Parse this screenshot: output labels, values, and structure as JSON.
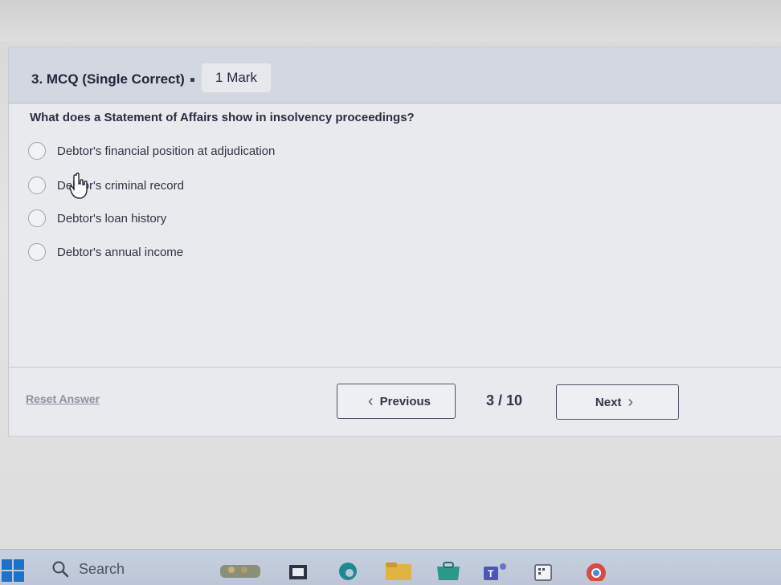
{
  "question_header": {
    "title": "3. MCQ (Single Correct)",
    "marks": "1 Mark"
  },
  "question": {
    "text": "What does a Statement of Affairs show in insolvency proceedings?",
    "options": [
      {
        "label": "Debtor's financial position at adjudication",
        "selected": false
      },
      {
        "label": "Debtor's criminal record",
        "selected": false
      },
      {
        "label": "Debtor's loan history",
        "selected": false
      },
      {
        "label": "Debtor's annual income",
        "selected": false
      }
    ]
  },
  "footer": {
    "reset_label": "Reset Answer",
    "previous_label": "Previous",
    "next_label": "Next",
    "pager": "3 / 10"
  },
  "taskbar": {
    "search_label": "Search",
    "icons": [
      "windows-start-icon",
      "search-icon",
      "widgets-icon",
      "file-explorer-icon",
      "edge-icon",
      "folder-icon",
      "store-icon",
      "teams-icon",
      "app-icon",
      "chrome-icon"
    ]
  },
  "colors": {
    "header_bg": "#d3d7e1",
    "card_bg": "#e9eaee",
    "button_border": "#505466"
  }
}
